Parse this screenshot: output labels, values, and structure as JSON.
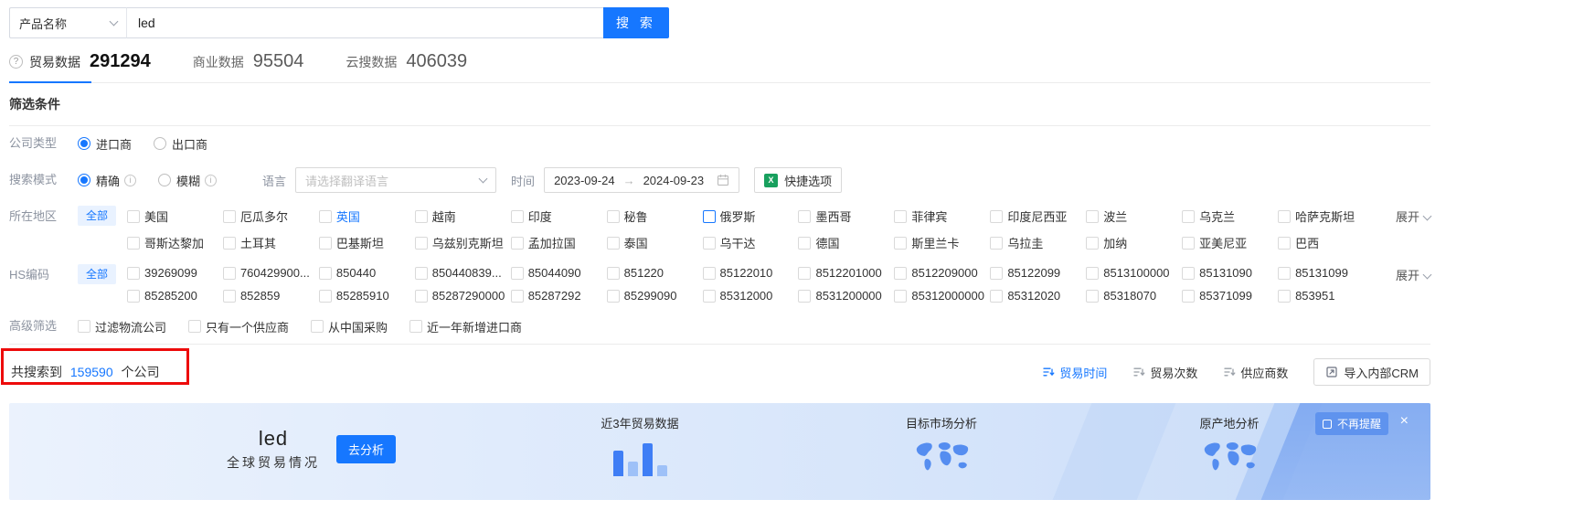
{
  "search": {
    "category": "产品名称",
    "value": "led",
    "button_label": "搜 索"
  },
  "tabs": [
    {
      "label": "贸易数据",
      "count": "291294"
    },
    {
      "label": "商业数据",
      "count": "95504"
    },
    {
      "label": "云搜数据",
      "count": "406039"
    }
  ],
  "filter": {
    "section_title": "筛选条件",
    "company_type": {
      "label": "公司类型",
      "options": [
        {
          "label": "进口商",
          "checked": true
        },
        {
          "label": "出口商",
          "checked": false
        }
      ]
    },
    "search_mode": {
      "label": "搜索模式",
      "options": [
        {
          "label": "精确",
          "checked": true
        },
        {
          "label": "模糊",
          "checked": false
        }
      ]
    },
    "language": {
      "label": "语言",
      "placeholder": "请选择翻译语言"
    },
    "time": {
      "label": "时间",
      "start": "2023-09-24",
      "arrow": "→",
      "end": "2024-09-23"
    },
    "quick_option_label": "快捷选项",
    "region": {
      "label": "所在地区",
      "all_label": "全部",
      "expand_label": "展开",
      "items": [
        {
          "label": "美国"
        },
        {
          "label": "厄瓜多尔"
        },
        {
          "label": "英国",
          "cls": "highlight"
        },
        {
          "label": "越南"
        },
        {
          "label": "印度"
        },
        {
          "label": "秘鲁"
        },
        {
          "label": "俄罗斯",
          "cls": "box-active"
        },
        {
          "label": "墨西哥"
        },
        {
          "label": "菲律宾"
        },
        {
          "label": "印度尼西亚"
        },
        {
          "label": "波兰"
        },
        {
          "label": "乌克兰"
        },
        {
          "label": "哈萨克斯坦"
        },
        {
          "label": "哥斯达黎加"
        },
        {
          "label": "土耳其"
        },
        {
          "label": "巴基斯坦"
        },
        {
          "label": "乌兹别克斯坦"
        },
        {
          "label": "孟加拉国"
        },
        {
          "label": "泰国"
        },
        {
          "label": "乌干达"
        },
        {
          "label": "德国"
        },
        {
          "label": "斯里兰卡"
        },
        {
          "label": "乌拉圭"
        },
        {
          "label": "加纳"
        },
        {
          "label": "亚美尼亚"
        },
        {
          "label": "巴西"
        }
      ]
    },
    "hs_code": {
      "label": "HS编码",
      "all_label": "全部",
      "expand_label": "展开",
      "items": [
        {
          "label": "39269099"
        },
        {
          "label": "760429900..."
        },
        {
          "label": "850440"
        },
        {
          "label": "850440839..."
        },
        {
          "label": "85044090"
        },
        {
          "label": "851220"
        },
        {
          "label": "85122010"
        },
        {
          "label": "8512201000"
        },
        {
          "label": "8512209000"
        },
        {
          "label": "85122099"
        },
        {
          "label": "8513100000"
        },
        {
          "label": "85131090"
        },
        {
          "label": "85131099"
        },
        {
          "label": "85285200"
        },
        {
          "label": "852859"
        },
        {
          "label": "85285910"
        },
        {
          "label": "85287290000"
        },
        {
          "label": "85287292"
        },
        {
          "label": "85299090"
        },
        {
          "label": "85312000"
        },
        {
          "label": "8531200000"
        },
        {
          "label": "85312000000"
        },
        {
          "label": "85312020"
        },
        {
          "label": "85318070"
        },
        {
          "label": "85371099"
        },
        {
          "label": "853951"
        }
      ]
    },
    "advanced": {
      "label": "高级筛选",
      "items": [
        {
          "label": "过滤物流公司"
        },
        {
          "label": "只有一个供应商"
        },
        {
          "label": "从中国采购"
        },
        {
          "label": "近一年新增进口商"
        }
      ]
    }
  },
  "results": {
    "prefix": "共搜索到",
    "count": "159590",
    "suffix": "个公司",
    "sorts": [
      {
        "label": "贸易时间",
        "cls": "active"
      },
      {
        "label": "贸易次数"
      },
      {
        "label": "供应商数"
      }
    ],
    "crm_button": "导入内部CRM"
  },
  "banner": {
    "keyword": "led",
    "subtitle": "全球贸易情况",
    "analyze_label": "去分析",
    "trade_card": "近3年贸易数据",
    "market_card": "目标市场分析",
    "origin_card": "原产地分析",
    "dismiss_label": "不再提醒",
    "close": "×"
  },
  "colors": {
    "primary": "#1677ff",
    "annotation_red": "#ed0b0b",
    "banner_start": "#ebf2fd",
    "banner_end": "#c9dcf8"
  }
}
